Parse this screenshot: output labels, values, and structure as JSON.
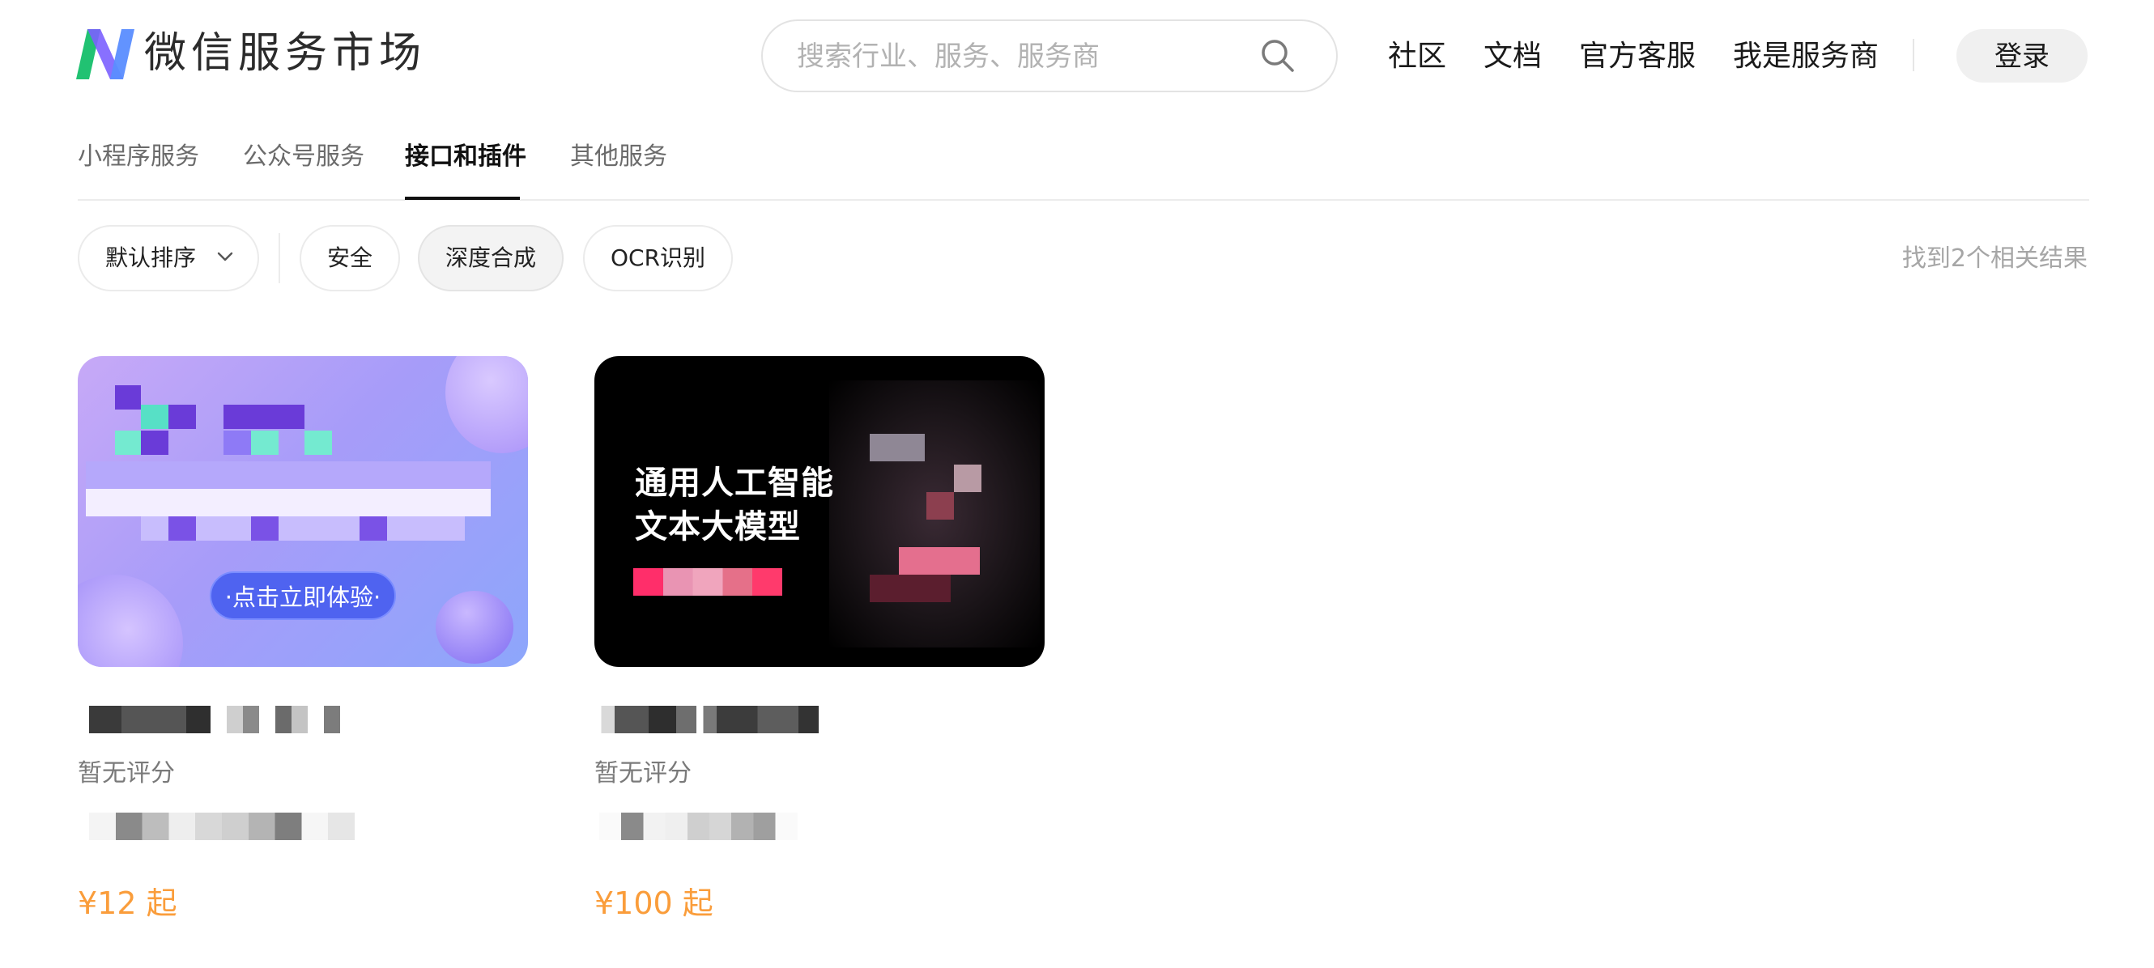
{
  "header": {
    "logo_text": "微信服务市场",
    "logo_icon": "wechat-service-market-logo-icon",
    "search_placeholder": "搜索行业、服务、服务商",
    "search_icon": "search-icon",
    "nav": [
      "社区",
      "文档",
      "官方客服",
      "我是服务商"
    ],
    "login_label": "登录"
  },
  "tabs": [
    {
      "label": "小程序服务",
      "active": false
    },
    {
      "label": "公众号服务",
      "active": false
    },
    {
      "label": "接口和插件",
      "active": true
    },
    {
      "label": "其他服务",
      "active": false
    }
  ],
  "filters": {
    "sort_label": "默认排序",
    "sort_icon": "chevron-down-icon",
    "chips": [
      {
        "label": "安全",
        "selected": false
      },
      {
        "label": "深度合成",
        "selected": true
      },
      {
        "label": "OCR识别",
        "selected": false
      }
    ],
    "result_count": "找到2个相关结果"
  },
  "products": [
    {
      "image_cta": "·点击立即体验·",
      "rating": "暂无评分",
      "price": "¥12 起"
    },
    {
      "image_text": [
        "通用人工智能",
        "文本大模型"
      ],
      "rating": "暂无评分",
      "price": "¥100 起"
    }
  ],
  "colors": {
    "accent_price": "#fa9d3b",
    "logo_green": "#21c272",
    "logo_purple": "#7b61ff",
    "active_tab": "#111111"
  }
}
